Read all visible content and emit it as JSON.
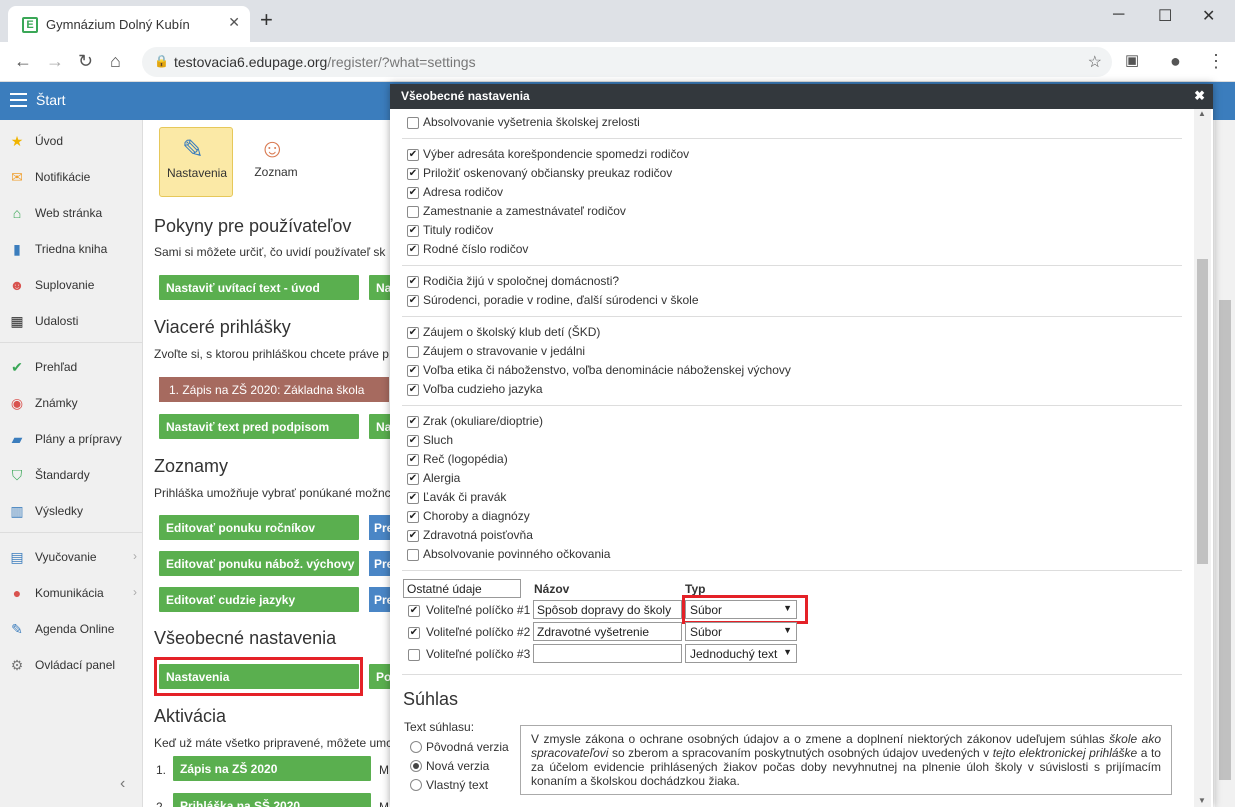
{
  "browser": {
    "tab_title": "Gymnázium Dolný Kubín",
    "url_host": "testovacia6.edupage.org",
    "url_path": "/register/?what=settings"
  },
  "app": {
    "start_label": "Štart"
  },
  "sidebar": {
    "items": [
      {
        "label": "Úvod",
        "icon": "star-icon",
        "color": "#f0b400"
      },
      {
        "label": "Notifikácie",
        "icon": "mail-icon",
        "color": "#f0a030"
      },
      {
        "label": "Web stránka",
        "icon": "home-icon",
        "color": "#3aa757"
      },
      {
        "label": "Triedna kniha",
        "icon": "book-icon",
        "color": "#3b7dbd"
      },
      {
        "label": "Suplovanie",
        "icon": "person-icon",
        "color": "#d9534f"
      },
      {
        "label": "Udalosti",
        "icon": "calendar-icon",
        "color": "#333333"
      },
      {
        "label": "Prehľad",
        "icon": "check-circle-icon",
        "color": "#3aa757"
      },
      {
        "label": "Známky",
        "icon": "grade-icon",
        "color": "#d9534f"
      },
      {
        "label": "Plány a prípravy",
        "icon": "briefcase-icon",
        "color": "#3b7dbd"
      },
      {
        "label": "Štandardy",
        "icon": "shield-icon",
        "color": "#3aa757"
      },
      {
        "label": "Výsledky",
        "icon": "bar-chart-icon",
        "color": "#3b7dbd"
      },
      {
        "label": "Vyučovanie",
        "icon": "open-book-icon",
        "color": "#3b7dbd"
      },
      {
        "label": "Komunikácia",
        "icon": "chat-icon",
        "color": "#d9534f"
      },
      {
        "label": "Agenda Online",
        "icon": "pen-icon",
        "color": "#3b7dbd"
      },
      {
        "label": "Ovládací panel",
        "icon": "gear-icon",
        "color": "#777777"
      }
    ]
  },
  "toolbar": {
    "settings_label": "Nastavenia",
    "list_label": "Zoznam"
  },
  "main": {
    "sections": {
      "pokyny_title": "Pokyny pre používateľov",
      "pokyny_desc": "Sami si môžete určiť, čo uvidí používateľ sk",
      "pokyny_btn": "Nastaviť uvítací text - úvod",
      "pokyny_btn2": "Na",
      "viacere_title": "Viaceré prihlášky",
      "viacere_desc": "Zvoľte si, s ktorou prihláškou chcete práve p",
      "viacere_btn": "1. Zápis na ZŠ 2020: Základna škola",
      "viacere_btn2": "Nastaviť text pred podpisom",
      "viacere_btn3": "Na",
      "zoznamy_title": "Zoznamy",
      "zoznamy_desc": "Prihláška umožňuje vybrať ponúkané možnc",
      "zoznamy_btn1": "Editovať ponuku ročníkov",
      "zoznamy_btn2": "Editovať ponuku nábož. výchovy",
      "zoznamy_btn3": "Editovať cudzie jazyky",
      "zoznamy_side": "Pre",
      "vseob_title": "Všeobecné nastavenia",
      "vseob_btn": "Nastavenia",
      "vseob_btn2": "Po",
      "aktiv_title": "Aktivácia",
      "aktiv_desc": "Keď už máte všetko pripravené, môžete umc",
      "aktiv_n1": "1.",
      "aktiv_item1": "Zápis na ZŠ 2020",
      "aktiv_item1_side": "M",
      "aktiv_n2": "2.",
      "aktiv_item2": "Prihláška na SŠ 2020",
      "aktiv_item2_side": "M"
    }
  },
  "modal": {
    "title": "Všeobecné nastavenia",
    "checks": [
      {
        "label": "Absolvovanie vyšetrenia školskej zrelosti",
        "checked": false
      },
      {
        "label": "Výber adresáta korešpondencie spomedzi rodičov",
        "checked": true
      },
      {
        "label": "Priložiť oskenovaný občiansky preukaz rodičov",
        "checked": true
      },
      {
        "label": "Adresa rodičov",
        "checked": true
      },
      {
        "label": "Zamestnanie a zamestnávateľ rodičov",
        "checked": false
      },
      {
        "label": "Tituly rodičov",
        "checked": true
      },
      {
        "label": "Rodné číslo rodičov",
        "checked": true
      },
      {
        "label": "Rodičia žijú v spoločnej domácnosti?",
        "checked": true
      },
      {
        "label": "Súrodenci, poradie v rodine, ďalší súrodenci v škole",
        "checked": true
      },
      {
        "label": "Záujem o školský klub detí (ŠKD)",
        "checked": true
      },
      {
        "label": "Záujem o stravovanie v jedálni",
        "checked": false
      },
      {
        "label": "Voľba etika či náboženstvo, voľba denominácie náboženskej výchovy",
        "checked": true
      },
      {
        "label": "Voľba cudzieho jazyka",
        "checked": true
      },
      {
        "label": "Zrak (okuliare/dioptrie)",
        "checked": true
      },
      {
        "label": "Sluch",
        "checked": true
      },
      {
        "label": "Reč (logopédia)",
        "checked": true
      },
      {
        "label": "Alergia",
        "checked": true
      },
      {
        "label": "Ľavák či pravák",
        "checked": true
      },
      {
        "label": "Choroby a diagnózy",
        "checked": true
      },
      {
        "label": "Zdravotná poisťovňa",
        "checked": true
      },
      {
        "label": "Absolvovanie povinného očkovania",
        "checked": false
      }
    ],
    "other": {
      "input_value": "Ostatné údaje",
      "col_name": "Názov",
      "col_type": "Typ",
      "rows": [
        {
          "label": "Voliteľné políčko #1",
          "checked": true,
          "name": "Spôsob dopravy do školy",
          "type": "Súbor"
        },
        {
          "label": "Voliteľné políčko #2",
          "checked": true,
          "name": "Zdravotné vyšetrenie",
          "type": "Súbor"
        },
        {
          "label": "Voliteľné políčko #3",
          "checked": false,
          "name": "",
          "type": "Jednoduchý text"
        }
      ]
    },
    "consent": {
      "title": "Súhlas",
      "text_label": "Text súhlasu:",
      "options": [
        {
          "label": "Pôvodná verzia",
          "selected": false
        },
        {
          "label": "Nová verzia",
          "selected": true
        },
        {
          "label": "Vlastný text",
          "selected": false
        }
      ],
      "text_part1": "V zmysle zákona o ochrane osobných údajov a o zmene a doplnení niektorých zákonov udeľujem súhlas ",
      "text_em1": "škole ako spracovateľovi",
      "text_part2": " so zberom a spracovaním poskytnutých osobných údajov uvedených v ",
      "text_em2": "tejto elektronickej prihláške",
      "text_part3": " a to za účelom evidencie prihlásených žiakov počas doby nevyhnutnej na plnenie úloh školy v súvislosti s prijímacím konaním a školskou dochádzkou žiaka."
    }
  }
}
